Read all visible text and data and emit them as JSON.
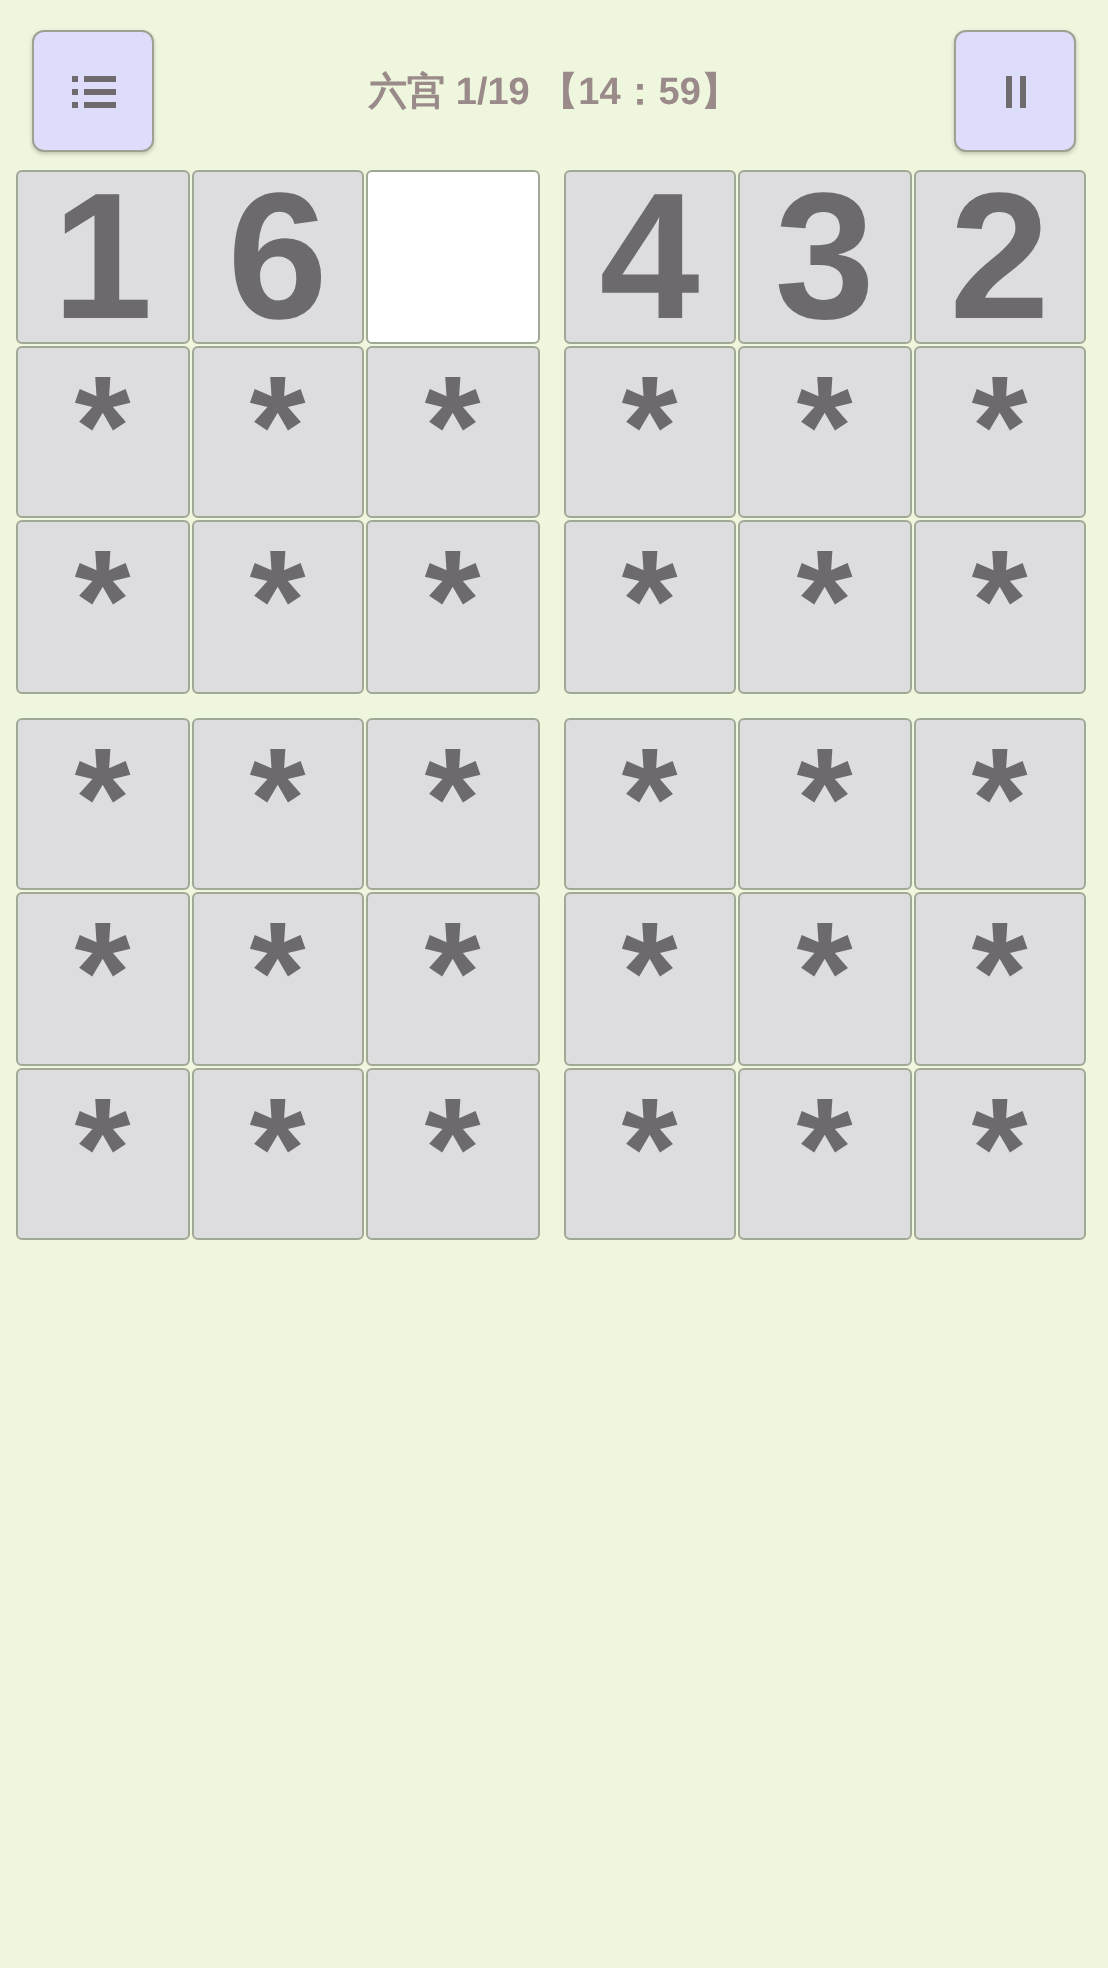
{
  "header": {
    "title": "六宫 1/19 【14：59】"
  },
  "grid": [
    [
      {
        "text": "1",
        "selected": false
      },
      {
        "text": "6",
        "selected": false
      },
      {
        "selected": true
      },
      {
        "text": "4",
        "selected": false
      },
      {
        "text": "3",
        "selected": false
      },
      {
        "text": "2",
        "selected": false
      }
    ],
    [
      {
        "text": "*",
        "selected": false
      },
      {
        "text": "*",
        "selected": false
      },
      {
        "text": "*",
        "selected": false
      },
      {
        "text": "*",
        "selected": false
      },
      {
        "text": "*",
        "selected": false
      },
      {
        "text": "*",
        "selected": false
      }
    ],
    [
      {
        "text": "*",
        "selected": false
      },
      {
        "text": "*",
        "selected": false
      },
      {
        "text": "*",
        "selected": false
      },
      {
        "text": "*",
        "selected": false
      },
      {
        "text": "*",
        "selected": false
      },
      {
        "text": "*",
        "selected": false
      }
    ],
    [
      {
        "text": "*",
        "selected": false
      },
      {
        "text": "*",
        "selected": false
      },
      {
        "text": "*",
        "selected": false
      },
      {
        "text": "*",
        "selected": false
      },
      {
        "text": "*",
        "selected": false
      },
      {
        "text": "*",
        "selected": false
      }
    ],
    [
      {
        "text": "*",
        "selected": false
      },
      {
        "text": "*",
        "selected": false
      },
      {
        "text": "*",
        "selected": false
      },
      {
        "text": "*",
        "selected": false
      },
      {
        "text": "*",
        "selected": false
      },
      {
        "text": "*",
        "selected": false
      }
    ],
    [
      {
        "text": "*",
        "selected": false
      },
      {
        "text": "*",
        "selected": false
      },
      {
        "text": "*",
        "selected": false
      },
      {
        "text": "*",
        "selected": false
      },
      {
        "text": "*",
        "selected": false
      },
      {
        "text": "*",
        "selected": false
      }
    ]
  ]
}
